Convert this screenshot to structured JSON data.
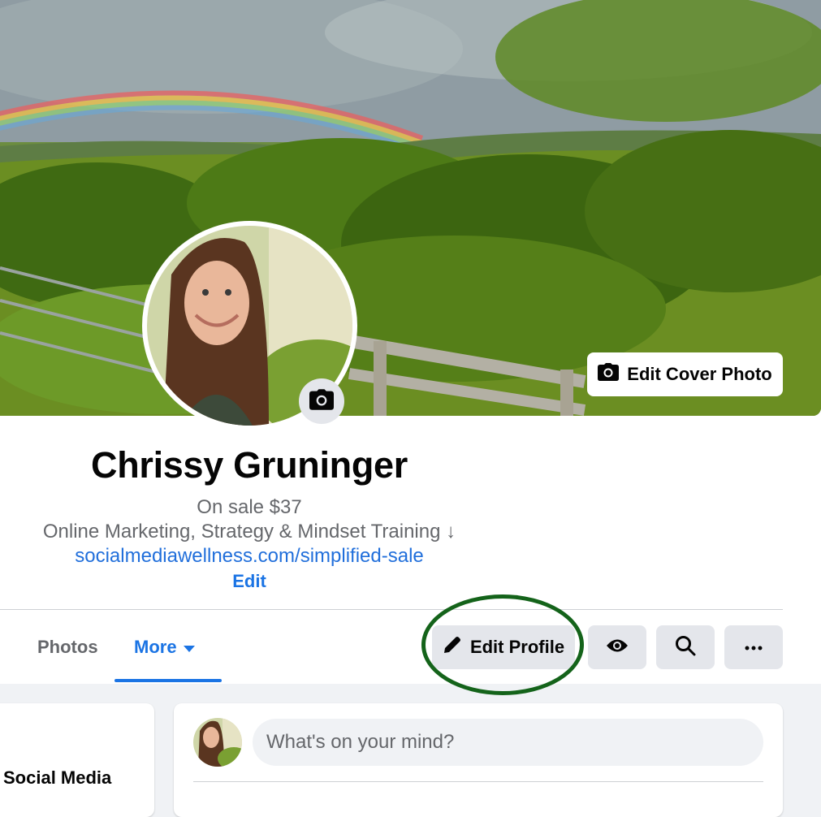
{
  "profile": {
    "name": "Chrissy Gruninger",
    "bio_lines": [
      "On sale $37",
      "Online Marketing, Strategy & Mindset Training ↓"
    ],
    "link": "socialmediawellness.com/simplified-sale",
    "edit_bio_label": "Edit"
  },
  "cover": {
    "edit_cover_label": "Edit Cover Photo"
  },
  "tabs": [
    {
      "label": "Photos",
      "active": false
    },
    {
      "label": "More",
      "active": true
    }
  ],
  "actions": {
    "edit_profile_label": "Edit Profile"
  },
  "sidebar": {
    "intro_text": "Social Media"
  },
  "composer": {
    "placeholder": "What's on your mind?"
  },
  "colors": {
    "accent": "#1b74e4",
    "link": "#216fdb",
    "highlight": "#14631a",
    "button_bg": "#e4e6eb",
    "page_bg": "#f0f2f5"
  },
  "icons": [
    "camera-icon",
    "pencil-icon",
    "eye-icon",
    "search-icon",
    "ellipsis-icon",
    "caret-down-icon"
  ]
}
